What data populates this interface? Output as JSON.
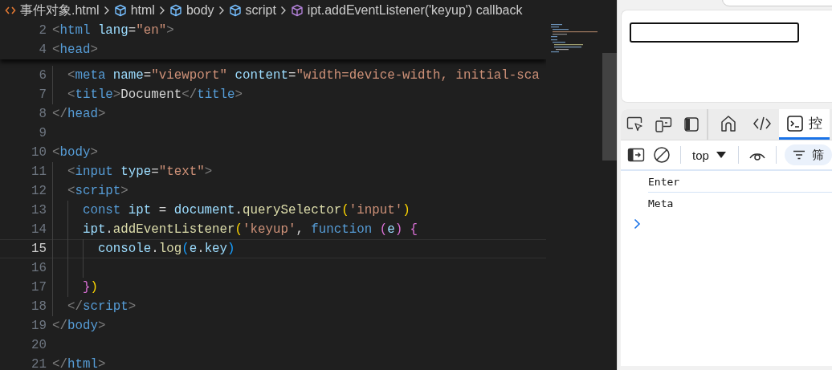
{
  "breadcrumbs": [
    {
      "kind": "file",
      "label": "事件对象.html"
    },
    {
      "kind": "element",
      "label": "html"
    },
    {
      "kind": "element",
      "label": "body"
    },
    {
      "kind": "element",
      "label": "script"
    },
    {
      "kind": "method",
      "label": "ipt.addEventListener('keyup') callback"
    }
  ],
  "sticky_lines": [
    {
      "number": "2",
      "tokens": [
        {
          "kind": "punct",
          "text": "<"
        },
        {
          "kind": "tag",
          "text": "html"
        },
        {
          "kind": "attr",
          "text": " lang"
        },
        {
          "kind": "text",
          "text": "="
        },
        {
          "kind": "string",
          "text": "\"en\""
        },
        {
          "kind": "punct",
          "text": ">"
        }
      ]
    },
    {
      "number": "4",
      "tokens": [
        {
          "kind": "punct",
          "text": "<"
        },
        {
          "kind": "tag",
          "text": "head"
        },
        {
          "kind": "punct",
          "text": ">"
        }
      ]
    }
  ],
  "lines": [
    {
      "number": "6",
      "current": false,
      "tokens": [
        {
          "kind": "punct",
          "text": "  <"
        },
        {
          "kind": "tag",
          "text": "meta"
        },
        {
          "kind": "attr",
          "text": " name"
        },
        {
          "kind": "text",
          "text": "="
        },
        {
          "kind": "string",
          "text": "\"viewport\""
        },
        {
          "kind": "attr",
          "text": " content"
        },
        {
          "kind": "text",
          "text": "="
        },
        {
          "kind": "string",
          "text": "\"width=device-width, initial-sca"
        }
      ]
    },
    {
      "number": "7",
      "current": false,
      "tokens": [
        {
          "kind": "punct",
          "text": "  <"
        },
        {
          "kind": "tag",
          "text": "title"
        },
        {
          "kind": "punct",
          "text": ">"
        },
        {
          "kind": "text",
          "text": "Document"
        },
        {
          "kind": "punct",
          "text": "</"
        },
        {
          "kind": "tag",
          "text": "title"
        },
        {
          "kind": "punct",
          "text": ">"
        }
      ]
    },
    {
      "number": "8",
      "current": false,
      "tokens": [
        {
          "kind": "punct",
          "text": "</"
        },
        {
          "kind": "tag",
          "text": "head"
        },
        {
          "kind": "punct",
          "text": ">"
        }
      ]
    },
    {
      "number": "9",
      "current": false
    },
    {
      "number": "10",
      "current": false,
      "tokens": [
        {
          "kind": "punct",
          "text": "<"
        },
        {
          "kind": "tag",
          "text": "body"
        },
        {
          "kind": "punct",
          "text": ">"
        }
      ]
    },
    {
      "number": "11",
      "current": false,
      "tokens": [
        {
          "kind": "punct",
          "text": "  <"
        },
        {
          "kind": "tag",
          "text": "input"
        },
        {
          "kind": "attr",
          "text": " type"
        },
        {
          "kind": "text",
          "text": "="
        },
        {
          "kind": "string",
          "text": "\"text\""
        },
        {
          "kind": "punct",
          "text": ">"
        }
      ]
    },
    {
      "number": "12",
      "current": false,
      "tokens": [
        {
          "kind": "punct",
          "text": "  <"
        },
        {
          "kind": "tag",
          "text": "script"
        },
        {
          "kind": "punct",
          "text": ">"
        }
      ]
    },
    {
      "number": "13",
      "current": false,
      "tokens": [
        {
          "kind": "keyword",
          "text": "    const"
        },
        {
          "kind": "var",
          "text": " ipt"
        },
        {
          "kind": "text",
          "text": " = "
        },
        {
          "kind": "var",
          "text": "document"
        },
        {
          "kind": "text",
          "text": "."
        },
        {
          "kind": "func",
          "text": "querySelector"
        },
        {
          "kind": "bracket1",
          "text": "("
        },
        {
          "kind": "string",
          "text": "'input'"
        },
        {
          "kind": "bracket1",
          "text": ")"
        }
      ]
    },
    {
      "number": "14",
      "current": false,
      "tokens": [
        {
          "kind": "var",
          "text": "    ipt"
        },
        {
          "kind": "text",
          "text": "."
        },
        {
          "kind": "func",
          "text": "addEventListener"
        },
        {
          "kind": "bracket1",
          "text": "("
        },
        {
          "kind": "string",
          "text": "'keyup'"
        },
        {
          "kind": "text",
          "text": ", "
        },
        {
          "kind": "keyword",
          "text": "function"
        },
        {
          "kind": "bracket2",
          "text": " ("
        },
        {
          "kind": "var",
          "text": "e"
        },
        {
          "kind": "bracket2",
          "text": ")"
        },
        {
          "kind": "bracket2",
          "text": " {"
        }
      ]
    },
    {
      "number": "15",
      "current": true,
      "tokens": [
        {
          "kind": "var",
          "text": "      console"
        },
        {
          "kind": "text",
          "text": "."
        },
        {
          "kind": "func",
          "text": "log"
        },
        {
          "kind": "bracket3",
          "text": "("
        },
        {
          "kind": "var",
          "text": "e"
        },
        {
          "kind": "text",
          "text": "."
        },
        {
          "kind": "var",
          "text": "key"
        },
        {
          "kind": "bracket3",
          "text": ")"
        }
      ]
    },
    {
      "number": "16",
      "current": false
    },
    {
      "number": "17",
      "current": false,
      "tokens": [
        {
          "kind": "bracket2",
          "text": "    }"
        },
        {
          "kind": "bracket1",
          "text": ")"
        }
      ]
    },
    {
      "number": "18",
      "current": false,
      "tokens": [
        {
          "kind": "punct",
          "text": "  </"
        },
        {
          "kind": "tag",
          "text": "script"
        },
        {
          "kind": "punct",
          "text": ">"
        }
      ]
    },
    {
      "number": "19",
      "current": false,
      "tokens": [
        {
          "kind": "punct",
          "text": "</"
        },
        {
          "kind": "tag",
          "text": "body"
        },
        {
          "kind": "punct",
          "text": ">"
        }
      ]
    },
    {
      "number": "20",
      "current": false
    },
    {
      "number": "21",
      "current": false,
      "tokens": [
        {
          "kind": "punct",
          "text": "</"
        },
        {
          "kind": "tag",
          "text": "html"
        },
        {
          "kind": "punct",
          "text": ">"
        }
      ]
    }
  ],
  "devtools": {
    "tabs": [
      {
        "kind": "home",
        "selected": false
      },
      {
        "kind": "elements",
        "selected": false
      },
      {
        "kind": "console",
        "label": "控",
        "selected": true
      }
    ],
    "context": "top",
    "filter": "筛",
    "messages": [
      "Enter",
      "Meta"
    ]
  }
}
